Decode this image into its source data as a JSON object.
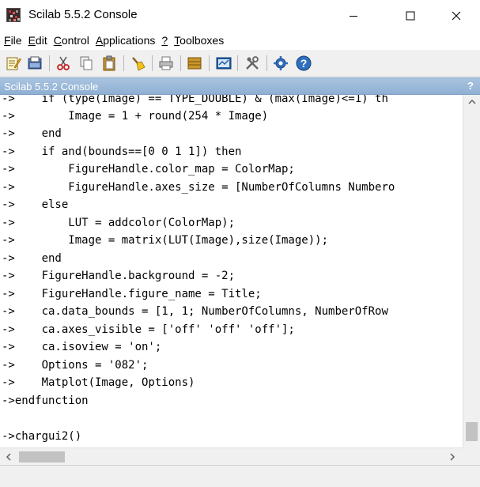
{
  "window": {
    "title": "Scilab 5.5.2 Console"
  },
  "menu": [
    {
      "label": "File",
      "underline": "F",
      "rest": "ile"
    },
    {
      "label": "Edit",
      "underline": "E",
      "rest": "dit"
    },
    {
      "label": "Control",
      "underline": "C",
      "rest": "ontrol"
    },
    {
      "label": "Applications",
      "underline": "A",
      "rest": "pplications"
    },
    {
      "label": "?",
      "underline": "?",
      "rest": ""
    },
    {
      "label": "Toolboxes",
      "underline": "T",
      "rest": "oolboxes"
    }
  ],
  "toolbar": {
    "icons": [
      "scinotes-icon",
      "open-folder-icon",
      "cut-icon",
      "copy-icon",
      "paste-icon",
      "clear-console-icon",
      "print-icon",
      "browser-icon",
      "variable-browser-icon",
      "module-manager-icon",
      "demos-icon",
      "help-icon"
    ]
  },
  "console": {
    "title": "Scilab 5.5.2 Console",
    "help_label": "?",
    "lines": [
      {
        "prompt": "->",
        "code": "    if (type(Image) == TYPE_DOUBLE) & (max(Image)<=1) th"
      },
      {
        "prompt": "->",
        "code": "        Image = 1 + round(254 * Image)"
      },
      {
        "prompt": "->",
        "code": "    end"
      },
      {
        "prompt": "->",
        "code": "    if and(bounds==[0 0 1 1]) then"
      },
      {
        "prompt": "->",
        "code": "        FigureHandle.color_map = ColorMap;"
      },
      {
        "prompt": "->",
        "code": "        FigureHandle.axes_size = [NumberOfColumns Numbero"
      },
      {
        "prompt": "->",
        "code": "    else"
      },
      {
        "prompt": "->",
        "code": "        LUT = addcolor(ColorMap);"
      },
      {
        "prompt": "->",
        "code": "        Image = matrix(LUT(Image),size(Image));"
      },
      {
        "prompt": "->",
        "code": "    end"
      },
      {
        "prompt": "->",
        "code": "    FigureHandle.background = -2;"
      },
      {
        "prompt": "->",
        "code": "    FigureHandle.figure_name = Title;"
      },
      {
        "prompt": "->",
        "code": "    ca.data_bounds = [1, 1; NumberOfColumns, NumberOfRow"
      },
      {
        "prompt": "->",
        "code": "    ca.axes_visible = ['off' 'off' 'off'];"
      },
      {
        "prompt": "->",
        "code": "    ca.isoview = 'on';"
      },
      {
        "prompt": "->",
        "code": "    Options = '082';"
      },
      {
        "prompt": "->",
        "code": "    Matplot(Image, Options)"
      },
      {
        "prompt": "->",
        "code": "endfunction"
      },
      {
        "prompt": "",
        "code": ""
      },
      {
        "prompt": "->",
        "code": "chargui2()"
      }
    ]
  },
  "colors": {
    "header_bg": "#9ab8d8",
    "header_text": "#ffffff"
  }
}
